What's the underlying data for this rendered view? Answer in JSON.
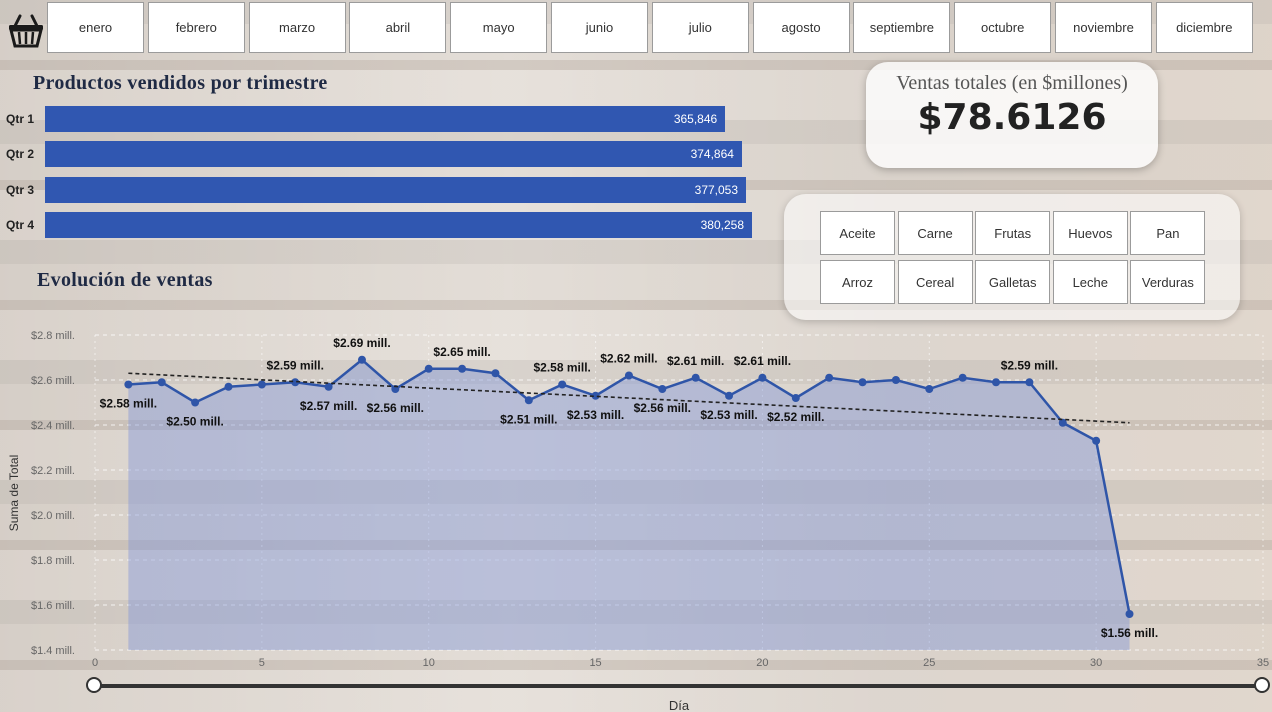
{
  "months": [
    "enero",
    "febrero",
    "marzo",
    "abril",
    "mayo",
    "junio",
    "julio",
    "agosto",
    "septiembre",
    "octubre",
    "noviembre",
    "diciembre"
  ],
  "bar_section": {
    "title": "Productos vendidos por trimestre"
  },
  "kpi": {
    "title": "Ventas totales (en $millones)",
    "value": "$78.6126"
  },
  "products": [
    "Aceite",
    "Carne",
    "Frutas",
    "Huevos",
    "Pan",
    "Arroz",
    "Cereal",
    "Galletas",
    "Leche",
    "Verduras"
  ],
  "line_section": {
    "title": "Evolución de ventas"
  },
  "colors": {
    "bar": "#3057b1",
    "line": "#2f55a8",
    "area": "rgba(130,150,215,0.45)"
  },
  "chart_data": [
    {
      "type": "bar",
      "orientation": "horizontal",
      "categories": [
        "Qtr 1",
        "Qtr 2",
        "Qtr 3",
        "Qtr 4"
      ],
      "values": [
        365846,
        374864,
        377053,
        380258
      ],
      "value_labels": [
        "365,846",
        "374,864",
        "377,053",
        "380,258"
      ],
      "title": "Productos vendidos por trimestre"
    },
    {
      "type": "area",
      "title": "Evolución de ventas",
      "xlabel": "Día",
      "ylabel": "Suma de Total",
      "xlim": [
        0,
        35
      ],
      "ylim": [
        1.4,
        2.8
      ],
      "xticks": [
        0,
        5,
        10,
        15,
        20,
        25,
        30,
        35
      ],
      "yticks": [
        {
          "v": 2.8,
          "label": "$2.8 mill."
        },
        {
          "v": 2.6,
          "label": "$2.6 mill."
        },
        {
          "v": 2.4,
          "label": "$2.4 mill."
        },
        {
          "v": 2.2,
          "label": "$2.2 mill."
        },
        {
          "v": 2.0,
          "label": "$2.0 mill."
        },
        {
          "v": 1.8,
          "label": "$1.8 mill."
        },
        {
          "v": 1.6,
          "label": "$1.6 mill."
        },
        {
          "v": 1.4,
          "label": "$1.4 mill."
        }
      ],
      "x": [
        1,
        2,
        3,
        4,
        5,
        6,
        7,
        8,
        9,
        10,
        11,
        12,
        13,
        14,
        15,
        16,
        17,
        18,
        19,
        20,
        21,
        22,
        23,
        24,
        25,
        26,
        27,
        28,
        29,
        30,
        31
      ],
      "values": [
        2.58,
        2.59,
        2.5,
        2.57,
        2.58,
        2.59,
        2.57,
        2.69,
        2.56,
        2.65,
        2.65,
        2.63,
        2.51,
        2.58,
        2.53,
        2.62,
        2.56,
        2.61,
        2.53,
        2.61,
        2.52,
        2.61,
        2.59,
        2.6,
        2.56,
        2.61,
        2.59,
        2.59,
        2.41,
        2.33,
        1.56
      ],
      "data_labels": [
        {
          "x": 1,
          "y": 2.58,
          "text": "$2.58 mill.",
          "pos": "below"
        },
        {
          "x": 3,
          "y": 2.5,
          "text": "$2.50 mill.",
          "pos": "below"
        },
        {
          "x": 6,
          "y": 2.59,
          "text": "$2.59 mill.",
          "pos": "above"
        },
        {
          "x": 7,
          "y": 2.57,
          "text": "$2.57 mill.",
          "pos": "below"
        },
        {
          "x": 8,
          "y": 2.69,
          "text": "$2.69 mill.",
          "pos": "above"
        },
        {
          "x": 9,
          "y": 2.56,
          "text": "$2.56 mill.",
          "pos": "below"
        },
        {
          "x": 11,
          "y": 2.65,
          "text": "$2.65 mill.",
          "pos": "above"
        },
        {
          "x": 13,
          "y": 2.51,
          "text": "$2.51 mill.",
          "pos": "below"
        },
        {
          "x": 14,
          "y": 2.58,
          "text": "$2.58 mill.",
          "pos": "above"
        },
        {
          "x": 15,
          "y": 2.53,
          "text": "$2.53 mill.",
          "pos": "below"
        },
        {
          "x": 16,
          "y": 2.62,
          "text": "$2.62 mill.",
          "pos": "above"
        },
        {
          "x": 17,
          "y": 2.56,
          "text": "$2.56 mill.",
          "pos": "below"
        },
        {
          "x": 18,
          "y": 2.61,
          "text": "$2.61 mill.",
          "pos": "above"
        },
        {
          "x": 19,
          "y": 2.53,
          "text": "$2.53 mill.",
          "pos": "below"
        },
        {
          "x": 20,
          "y": 2.61,
          "text": "$2.61 mill.",
          "pos": "above"
        },
        {
          "x": 21,
          "y": 2.52,
          "text": "$2.52 mill.",
          "pos": "below"
        },
        {
          "x": 28,
          "y": 2.59,
          "text": "$2.59 mill.",
          "pos": "above"
        },
        {
          "x": 31,
          "y": 1.56,
          "text": "$1.56 mill.",
          "pos": "below"
        }
      ],
      "trendline": {
        "from": {
          "x": 1,
          "y": 2.63
        },
        "to": {
          "x": 31,
          "y": 2.41
        },
        "style": "dashed"
      },
      "grid": true
    }
  ]
}
